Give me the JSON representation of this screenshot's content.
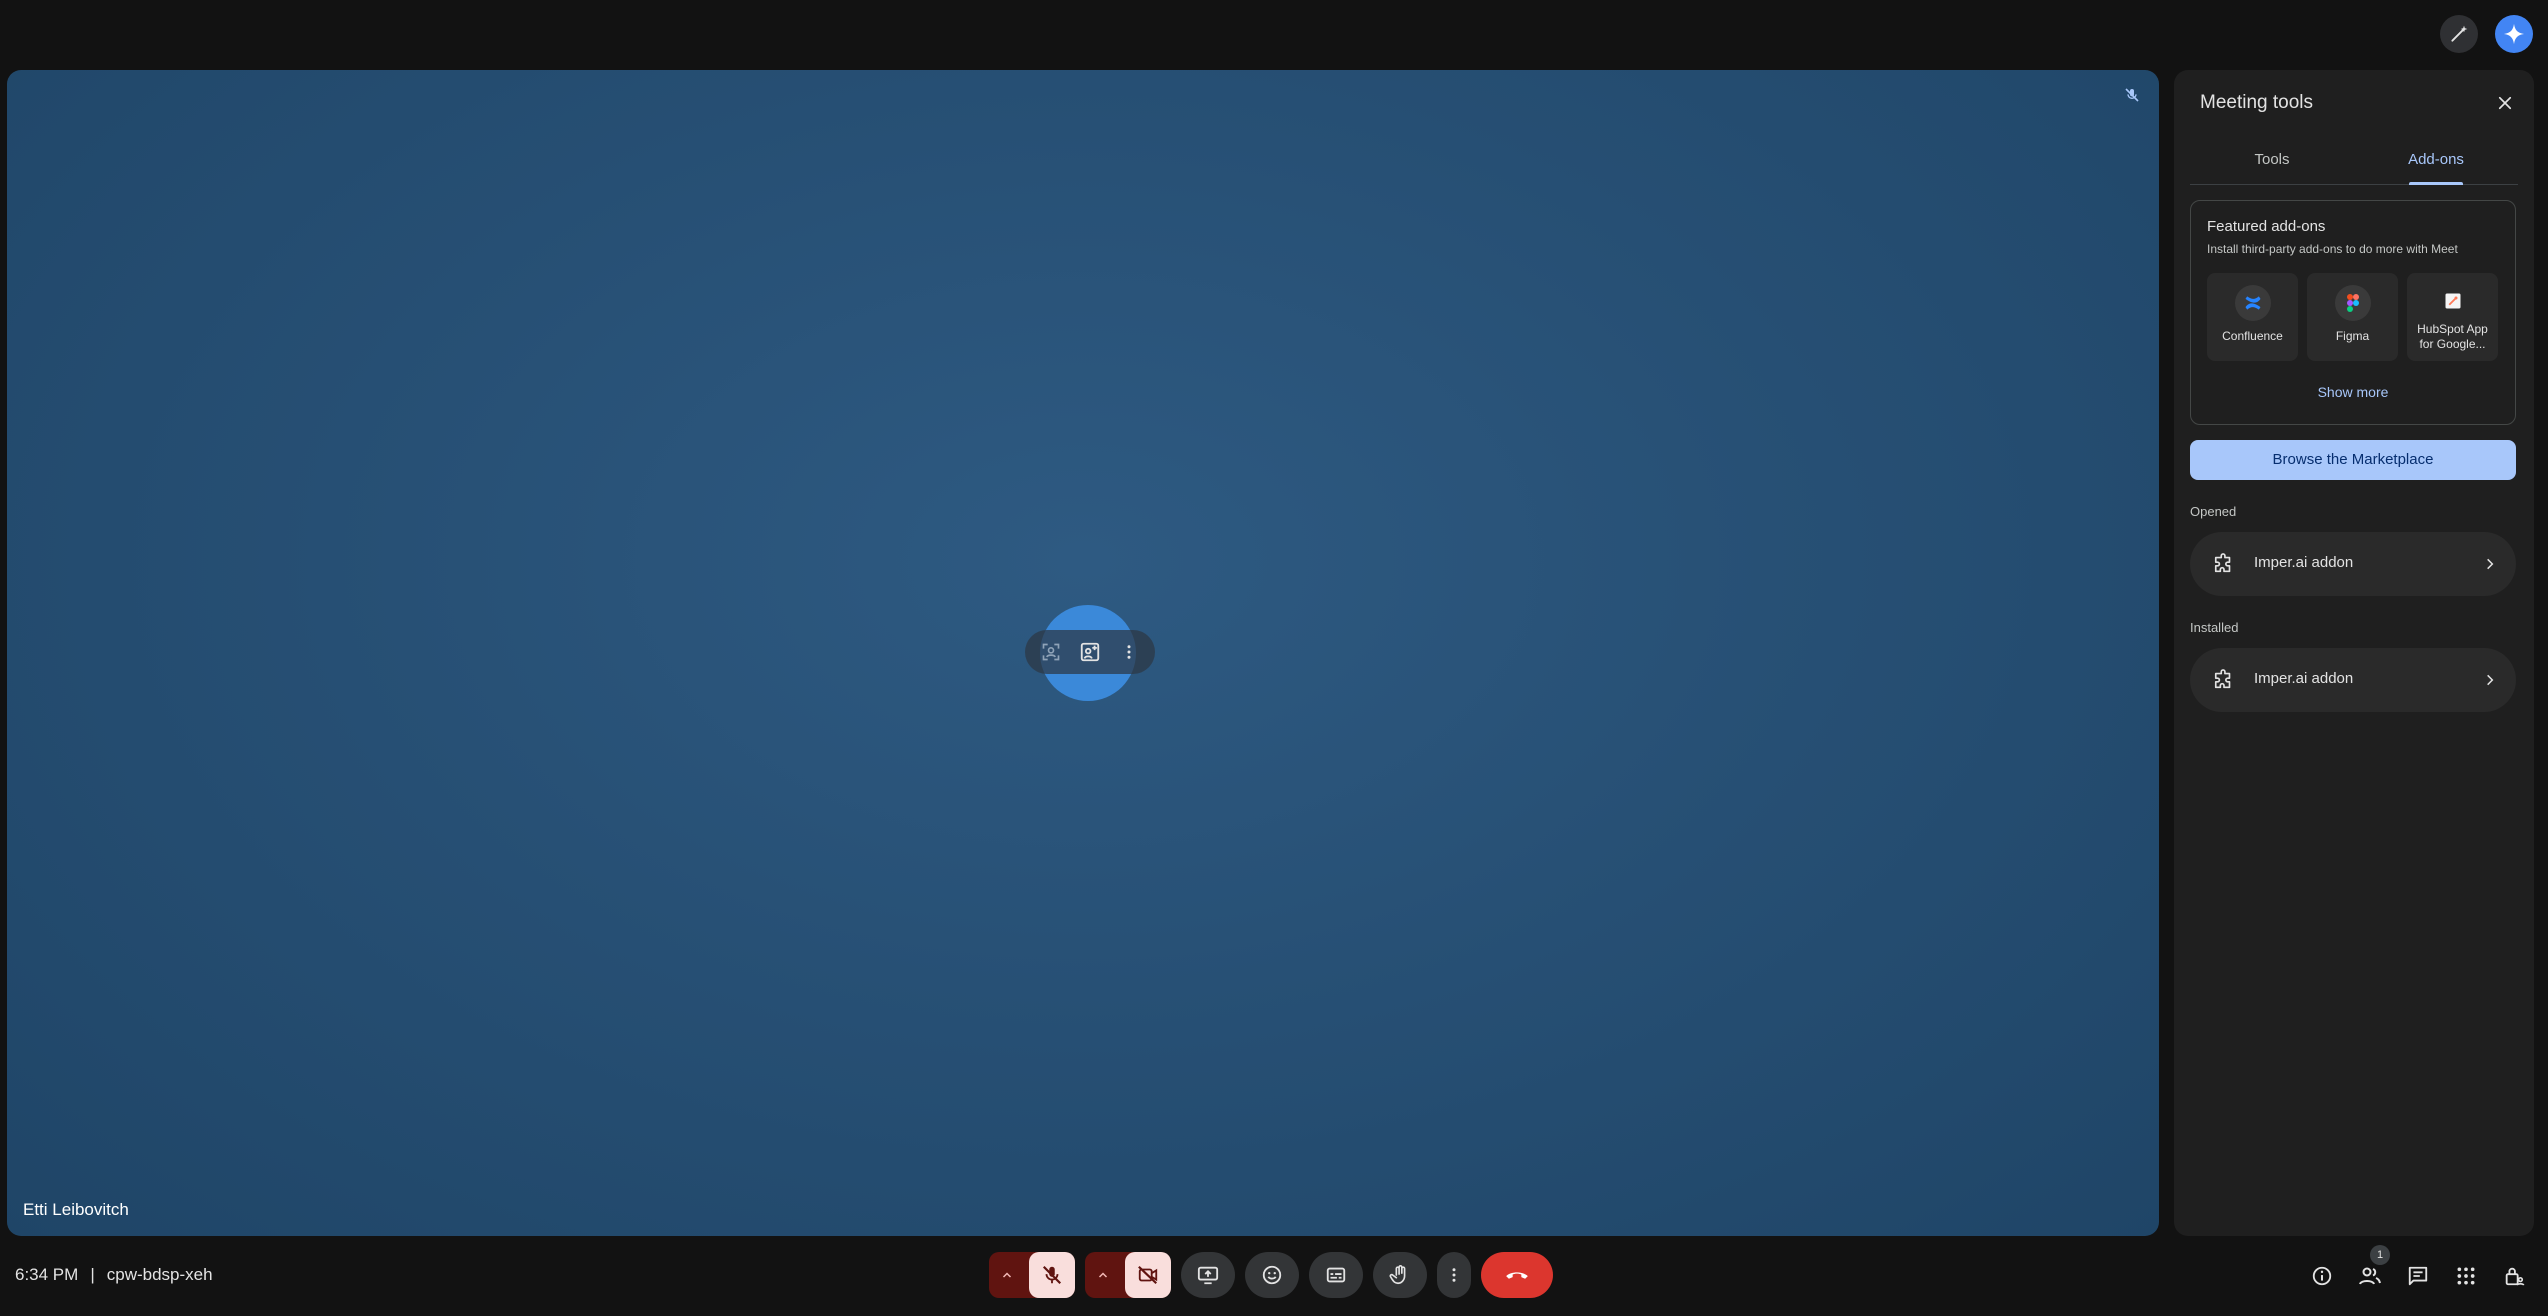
{
  "stage": {
    "participant_name": "Etti Leibovitch"
  },
  "panel": {
    "title": "Meeting tools",
    "tabs": [
      {
        "label": "Tools",
        "active": false
      },
      {
        "label": "Add-ons",
        "active": true
      }
    ],
    "featured": {
      "title": "Featured add-ons",
      "subtitle": "Install third-party add-ons to do more with Meet",
      "addons": [
        {
          "label": "Confluence",
          "icon": "confluence-icon"
        },
        {
          "label": "Figma",
          "icon": "figma-icon"
        },
        {
          "label": "HubSpot App for Google...",
          "icon": "hubspot-icon"
        }
      ],
      "show_more": "Show more"
    },
    "browse_label": "Browse the Marketplace",
    "opened_label": "Opened",
    "opened_items": [
      {
        "label": "Imper.ai addon"
      }
    ],
    "installed_label": "Installed",
    "installed_items": [
      {
        "label": "Imper.ai addon"
      }
    ]
  },
  "bottom": {
    "time": "6:34 PM",
    "separator": "|",
    "meeting_code": "cpw-bdsp-xeh",
    "people_count": "1"
  },
  "colors": {
    "accent": "#a8c7fa",
    "end_call": "#dc362e",
    "mute_dark": "#601410",
    "mute_light": "#f9dedc",
    "gemini": "#4285f4"
  }
}
